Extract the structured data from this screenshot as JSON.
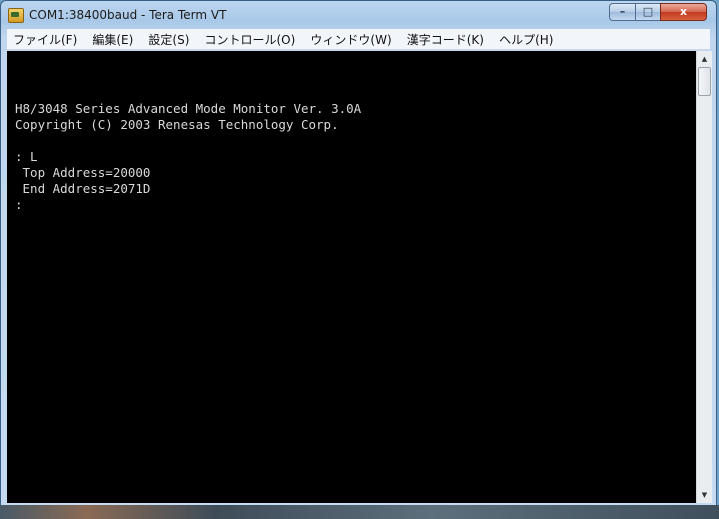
{
  "window": {
    "title": "COM1:38400baud - Tera Term VT",
    "controls": {
      "minimize": "–",
      "maximize": "□",
      "close": "x"
    },
    "icon": "tera-term-app-icon"
  },
  "menu": [
    "ファイル(F)",
    "編集(E)",
    "設定(S)",
    "コントロール(O)",
    "ウィンドウ(W)",
    "漢字コード(K)",
    "ヘルプ(H)"
  ],
  "terminal": {
    "lines": [
      "",
      "H8/3048 Series Advanced Mode Monitor Ver. 3.0A",
      "Copyright (C) 2003 Renesas Technology Corp.",
      "",
      ": L",
      " Top Address=20000",
      " End Address=2071D",
      ":"
    ]
  },
  "scrollbar": {
    "up": "▲",
    "down": "▼"
  }
}
